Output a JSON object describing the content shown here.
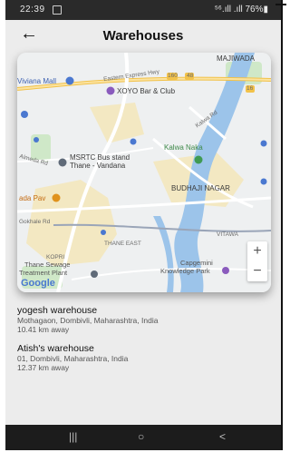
{
  "status": {
    "time": "22:39",
    "right": "⁵⁶.ıll .ıll 76%▮"
  },
  "header": {
    "title": "Warehouses",
    "back_icon": "←"
  },
  "map": {
    "labels": {
      "majiwada": "MAJIWADA",
      "viviana": "Viviana Mall",
      "xoyo": "XOYO Bar & Club",
      "eastern": "Eastern Express Hwy",
      "kalwa_naka": "Kalwa Naka",
      "msrtc": "MSRTC Bus stand",
      "msrtc2": "Thane - Vandana",
      "almeda": "Almeda Rd",
      "budhaji": "BUDHAJI NAGAR",
      "vada": "ada Pav",
      "gokhale": "Gokhale Rd",
      "thane_east": "THANE EAST",
      "vitawa": "VITAWA",
      "kopri": "KOPRI",
      "sewage": "Thane Sewage",
      "sewage2": "Treatment Plant",
      "capgemini": "Capgemini",
      "capgemini2": "Knowledge Park",
      "kalwa_rd": "Kalwa Rd",
      "rd_160": "160",
      "rd_48": "48",
      "rd_16": "16"
    },
    "zoom_in": "+",
    "zoom_out": "−",
    "google": "Google"
  },
  "warehouses": [
    {
      "name": "yogesh warehouse",
      "address": "Mothagaon, Dombivli, Maharashtra, India",
      "distance": "10.41 km away"
    },
    {
      "name": "Atish's warehouse",
      "address": "01, Dombivli, Maharashtra, India",
      "distance": "12.37 km away"
    }
  ],
  "navbar": {
    "recent": "|||",
    "home": "○",
    "back": "<"
  }
}
